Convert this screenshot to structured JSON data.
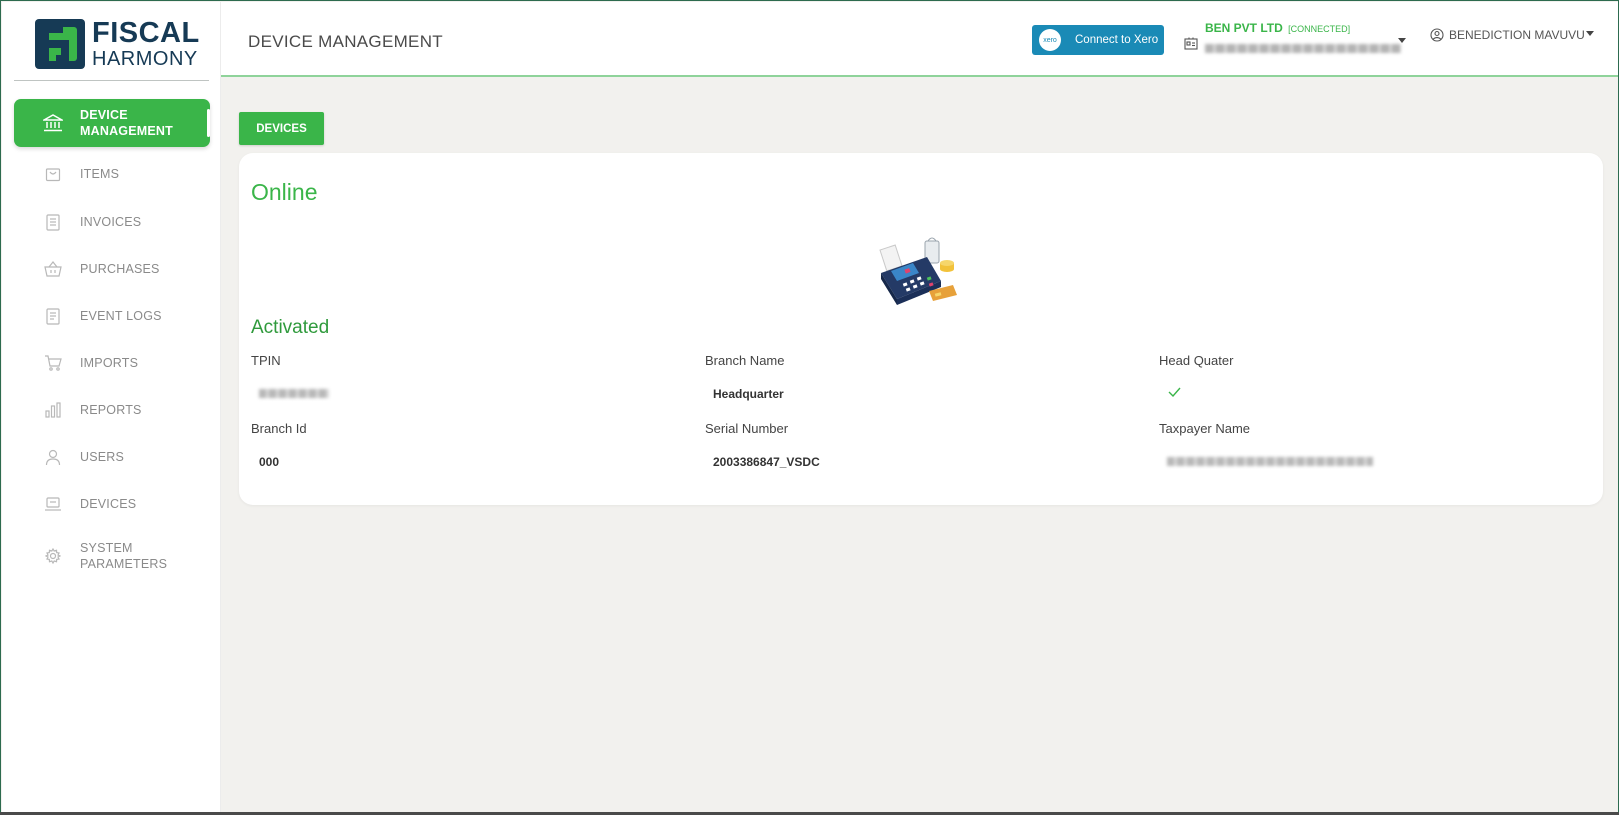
{
  "brand": {
    "name_line1": "FISCAL",
    "name_line2": "HARMONY",
    "colors": {
      "primary": "#3ab549",
      "navy": "#163a55",
      "xero": "#1a8ab6"
    }
  },
  "sidebar": {
    "items": [
      {
        "label": "DEVICE MANAGEMENT",
        "icon": "bank-icon",
        "active": true
      },
      {
        "label": "ITEMS",
        "icon": "bag-icon",
        "active": false
      },
      {
        "label": "INVOICES",
        "icon": "invoice-icon",
        "active": false
      },
      {
        "label": "PURCHASES",
        "icon": "basket-icon",
        "active": false
      },
      {
        "label": "EVENT LOGS",
        "icon": "log-icon",
        "active": false
      },
      {
        "label": "IMPORTS",
        "icon": "cart-icon",
        "active": false
      },
      {
        "label": "REPORTS",
        "icon": "bar-chart-icon",
        "active": false
      },
      {
        "label": "USERS",
        "icon": "user-icon",
        "active": false
      },
      {
        "label": "DEVICES",
        "icon": "laptop-icon",
        "active": false
      },
      {
        "label": "SYSTEM PARAMETERS",
        "icon": "gear-icon",
        "active": false
      }
    ]
  },
  "header": {
    "title": "DEVICE MANAGEMENT",
    "xero_button": "Connect to Xero",
    "xero_logo_text": "xero",
    "company_name": "BEN PVT LTD",
    "company_status": "[CONNECTED]",
    "user_name": "BENEDICTION MAVUVU"
  },
  "main": {
    "devices_button": "DEVICES",
    "status": "Online",
    "activation": "Activated",
    "fields": {
      "tpin_label": "TPIN",
      "branch_name_label": "Branch Name",
      "branch_name_value": "Headquarter",
      "head_quarter_label": "Head Quater",
      "branch_id_label": "Branch Id",
      "branch_id_value": "000",
      "serial_number_label": "Serial Number",
      "serial_number_value": "2003386847_VSDC",
      "taxpayer_name_label": "Taxpayer Name"
    }
  }
}
